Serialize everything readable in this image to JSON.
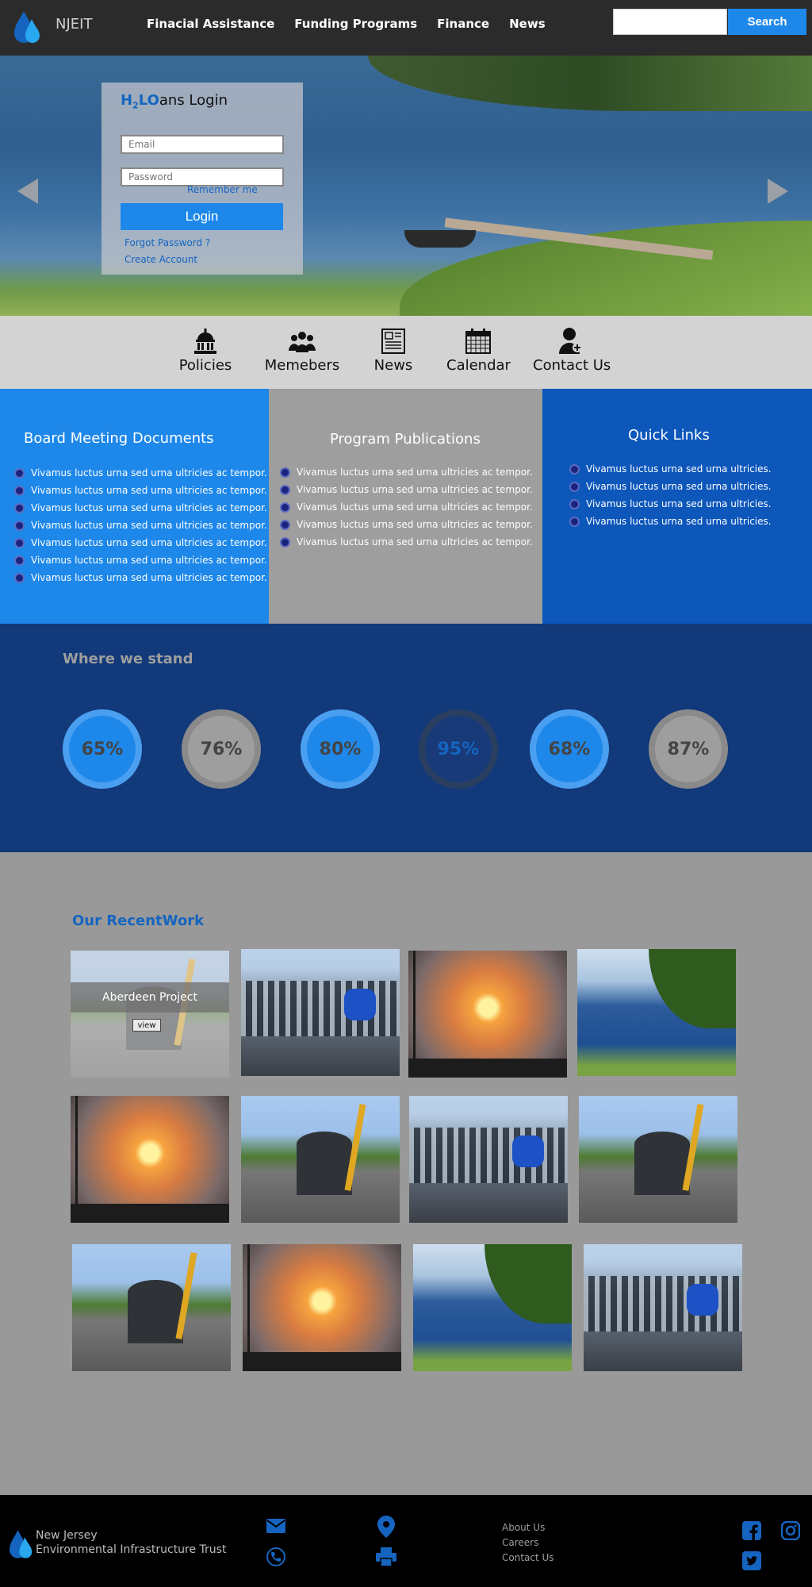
{
  "header": {
    "brand": "NJEIT",
    "nav": [
      "Finacial Assistance",
      "Funding Programs",
      "Finance",
      "News"
    ],
    "search_button": "Search"
  },
  "login": {
    "title_h": "H",
    "title_sub": "2",
    "title_lo": "LO",
    "title_rest": "ans Login",
    "email_placeholder": "Email",
    "password_placeholder": "Password",
    "remember": "Remember me",
    "button": "Login",
    "forgot": "Forgot Password ?",
    "create": "Create Account"
  },
  "iconbar": [
    {
      "label": "Policies",
      "icon": "capitol-icon"
    },
    {
      "label": "Memebers",
      "icon": "group-icon"
    },
    {
      "label": "News",
      "icon": "newspaper-icon"
    },
    {
      "label": "Calendar",
      "icon": "calendar-icon"
    },
    {
      "label": "Contact Us",
      "icon": "add-user-icon"
    }
  ],
  "panels": {
    "board": {
      "title": "Board Meeting Documents",
      "items": [
        "Vivamus luctus urna sed urna ultricies ac tempor.",
        "Vivamus luctus urna sed urna ultricies ac tempor.",
        "Vivamus luctus urna sed urna ultricies ac tempor.",
        "Vivamus luctus urna sed urna ultricies ac tempor.",
        "Vivamus luctus urna sed urna ultricies ac tempor.",
        "Vivamus luctus urna sed urna ultricies ac tempor.",
        "Vivamus luctus urna sed urna ultricies ac tempor."
      ]
    },
    "publications": {
      "title": "Program Publications",
      "items": [
        "Vivamus luctus urna sed urna ultricies ac tempor.",
        "Vivamus luctus urna sed urna ultricies ac tempor.",
        "Vivamus luctus urna sed urna ultricies ac tempor.",
        "Vivamus luctus urna sed urna ultricies ac tempor.",
        "Vivamus luctus urna sed urna ultricies ac tempor."
      ]
    },
    "quicklinks": {
      "title": "Quick Links",
      "items": [
        "Vivamus luctus urna sed urna ultricies.",
        "Vivamus luctus urna sed urna ultricies.",
        "Vivamus luctus urna sed urna ultricies.",
        "Vivamus luctus urna sed urna ultricies."
      ]
    }
  },
  "stand": {
    "title": "Where we stand",
    "stats": [
      "65%",
      "76%",
      "80%",
      "95%",
      "68%",
      "87%"
    ]
  },
  "recent": {
    "title": "Our RecentWork",
    "featured_caption": "Aberdeen Project",
    "featured_button": "view"
  },
  "footer": {
    "org_line1": "New Jersey",
    "org_line2": "Environmental Infrastructure Trust",
    "links": [
      "About Us",
      "Careers",
      "Contact Us"
    ]
  },
  "colors": {
    "accent": "#1e88ea",
    "panel_blue": "#1e88ea",
    "panel_gray": "#9e9e9e",
    "panel_dark_blue": "#0d57bb",
    "stand_bg": "#12397a"
  }
}
